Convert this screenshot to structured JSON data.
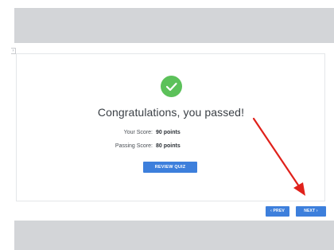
{
  "quiz_result": {
    "title": "Congratulations, you passed!",
    "your_score_label": "Your Score:",
    "your_score_value": "90 points",
    "passing_score_label": "Passing Score:",
    "passing_score_value": "80 points",
    "review_button": "REVIEW QUIZ"
  },
  "navigation": {
    "prev_label": "‹ PREV",
    "next_label": "NEXT ›"
  },
  "icons": {
    "status": "check-icon",
    "annotation": "red-arrow-icon"
  },
  "colors": {
    "success": "#5cc15a",
    "primary_button": "#3d7fdc",
    "annotation": "#e0211b",
    "band": "#d3d5d8"
  }
}
